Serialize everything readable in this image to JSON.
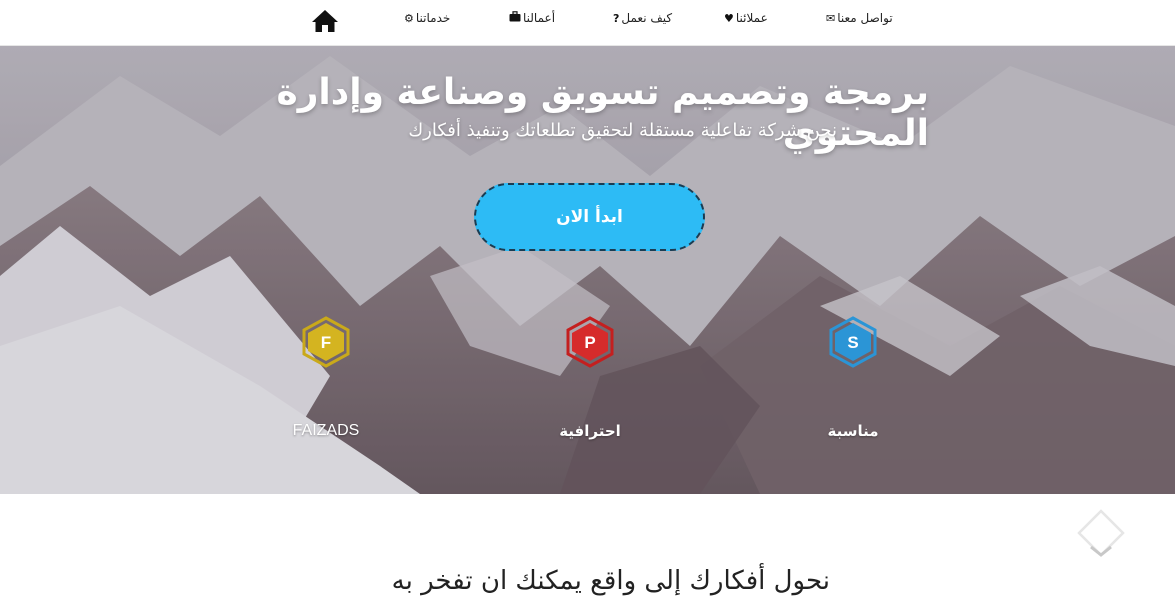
{
  "nav": {
    "items": [
      {
        "label": "تواصل معنا",
        "icon": "envelope-icon"
      },
      {
        "label": "عملائنا",
        "icon": "heart-icon"
      },
      {
        "label": "كيف نعمل",
        "icon": "question-icon"
      },
      {
        "label": "أعمالنا",
        "icon": "briefcase-icon"
      },
      {
        "label": "خدماتنا",
        "icon": "gears-icon"
      }
    ],
    "home_icon": "home-icon"
  },
  "hero": {
    "title": "برمجة وتصميم تسويق وصناعة وإدارة المحتوي",
    "subtitle": "نحن شركة تفاعلية مستقلة لتحقيق تطلعاتك وتنفيذ أفكارك",
    "cta_label": "ابدأ الان",
    "features": [
      {
        "letter": "S",
        "label": "مناسبة",
        "color": "#2b95d6",
        "icon": "hexagon-s-icon"
      },
      {
        "letter": "P",
        "label": "احترافية",
        "color": "#d62b2b",
        "icon": "hexagon-p-icon"
      },
      {
        "letter": "F",
        "label": "FAIZADS",
        "color": "#d4b420",
        "icon": "hexagon-f-icon"
      }
    ]
  },
  "section": {
    "title": "نحول أفكارك إلى واقع يمكنك ان تفخر به",
    "scroll_icon": "chevron-down-icon"
  },
  "colors": {
    "accent": "#2dbbf5",
    "cta_border": "#1a3c52",
    "text_dark": "#222222"
  }
}
